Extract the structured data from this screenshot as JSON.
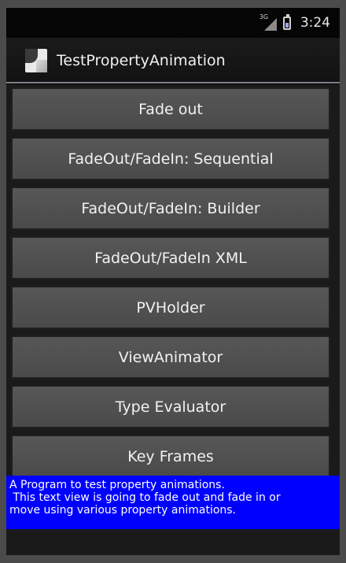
{
  "status_bar": {
    "network_label": "3G",
    "time": "3:24",
    "icons": [
      "signal-icon",
      "battery-icon"
    ]
  },
  "title_bar": {
    "app_title": "TestPropertyAnimation",
    "icon": "app-icon"
  },
  "buttons": [
    "Fade out",
    "FadeOut/FadeIn: Sequential",
    "FadeOut/FadeIn: Builder",
    "FadeOut/FadeIn XML",
    "PVHolder",
    "ViewAnimator",
    "Type Evaluator",
    "Key Frames"
  ],
  "info_text": {
    "lines": [
      "A Program to test property animations.",
      " This text view is going to fade out and fade in or",
      "move using various property animations."
    ]
  },
  "colors": {
    "info_background": "#0000ff",
    "button_background": "#505050",
    "app_background": "#1a1a1a"
  }
}
